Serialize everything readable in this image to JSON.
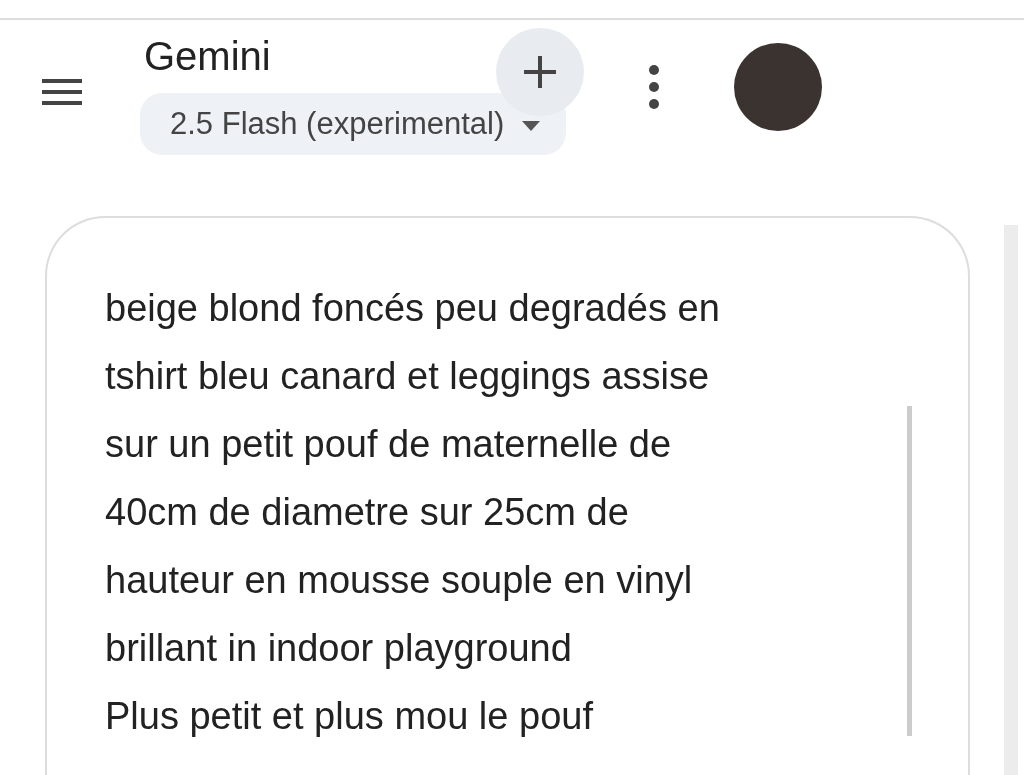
{
  "header": {
    "title": "Gemini",
    "model": "2.5 Flash (experimental)"
  },
  "prompt": {
    "paragraphs": [
      "beige blond foncés peu degradés en tshirt bleu canard et leggings assise sur un petit pouf de maternelle de 40cm de diametre sur 25cm de hauteur en mousse souple en vinyl brillant in indoor playground",
      "Plus petit et plus mou le pouf"
    ]
  }
}
